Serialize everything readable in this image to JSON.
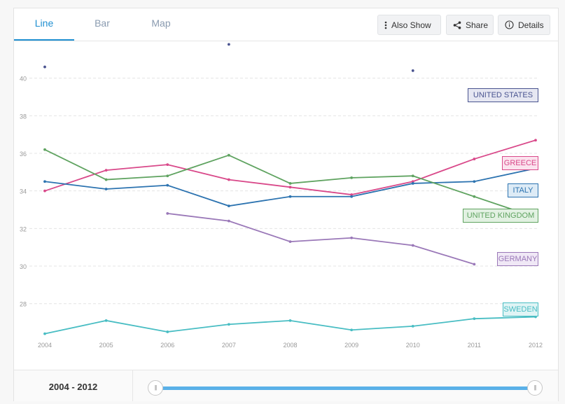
{
  "tabs": [
    {
      "label": "Line",
      "active": true
    },
    {
      "label": "Bar",
      "active": false
    },
    {
      "label": "Map",
      "active": false
    }
  ],
  "toolbar": {
    "also_show_label": "Also Show",
    "share_label": "Share",
    "details_label": "Details"
  },
  "icons": {
    "also_show": "vertical-dots-icon",
    "share": "share-icon",
    "details": "info-icon"
  },
  "range": {
    "label": "2004 - 2012",
    "start": 2004,
    "end": 2012
  },
  "chart_data": {
    "type": "line",
    "x": [
      2004,
      2005,
      2006,
      2007,
      2008,
      2009,
      2010,
      2011,
      2012
    ],
    "xlim": [
      2004,
      2012
    ],
    "ylim": [
      26.2,
      42
    ],
    "yticks": [
      28,
      30,
      32,
      34,
      36,
      38,
      40
    ],
    "grid": true,
    "series": [
      {
        "name": "UNITED STATES",
        "color": "#4a5490",
        "label_bg": "#e6e7f2",
        "values": [
          40.6,
          null,
          null,
          41.8,
          null,
          null,
          40.4,
          null,
          null
        ]
      },
      {
        "name": "GREECE",
        "color": "#d9498a",
        "label_bg": "#fbe3ee",
        "values": [
          34.0,
          35.1,
          35.4,
          34.6,
          34.2,
          33.8,
          34.5,
          35.7,
          36.7
        ]
      },
      {
        "name": "ITALY",
        "color": "#2c73b0",
        "label_bg": "#ddebf6",
        "values": [
          34.5,
          34.1,
          34.3,
          33.2,
          33.7,
          33.7,
          34.4,
          34.5,
          35.2
        ]
      },
      {
        "name": "UNITED KINGDOM",
        "color": "#5fa360",
        "label_bg": "#e2f1e2",
        "values": [
          36.2,
          34.6,
          34.8,
          35.9,
          34.4,
          34.7,
          34.8,
          33.7,
          32.6
        ]
      },
      {
        "name": "GERMANY",
        "color": "#9a78b8",
        "label_bg": "#f0e8f6",
        "values": [
          null,
          null,
          32.8,
          32.4,
          31.3,
          31.5,
          31.1,
          30.1,
          null
        ]
      },
      {
        "name": "SWEDEN",
        "color": "#48bdc3",
        "label_bg": "#dff4f5",
        "values": [
          26.4,
          27.1,
          26.5,
          26.9,
          27.1,
          26.6,
          26.8,
          27.2,
          27.3
        ]
      }
    ]
  }
}
